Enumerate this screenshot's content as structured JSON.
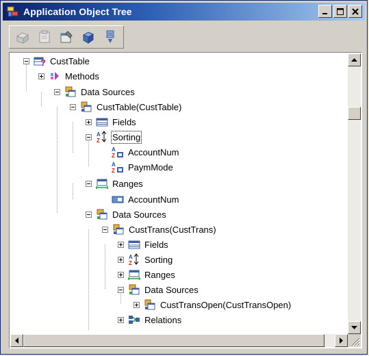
{
  "window": {
    "title": "Application Object Tree"
  },
  "toolbar": {
    "buttons": [
      "new-icon",
      "new-item-icon",
      "properties-icon",
      "save-icon",
      "filter-icon"
    ]
  },
  "tree": {
    "nodes": [
      {
        "label": "CustTable",
        "expander": "minus",
        "icon": "table-icon"
      },
      {
        "label": "Methods",
        "expander": "plus",
        "icon": "methods-icon"
      },
      {
        "label": "Data Sources",
        "expander": "minus",
        "icon": "data-sources-icon"
      },
      {
        "label": "CustTable(CustTable)",
        "expander": "minus",
        "icon": "data-source-icon"
      },
      {
        "label": "Fields",
        "expander": "plus",
        "icon": "fields-icon"
      },
      {
        "label": "Sorting",
        "expander": "minus",
        "icon": "sort-az-icon",
        "selected": true
      },
      {
        "label": "AccountNum",
        "expander": "",
        "icon": "sort-field-icon"
      },
      {
        "label": "PaymMode",
        "expander": "",
        "icon": "sort-field-icon"
      },
      {
        "label": "Ranges",
        "expander": "minus",
        "icon": "ranges-icon"
      },
      {
        "label": "AccountNum",
        "expander": "",
        "icon": "range-field-icon"
      },
      {
        "label": "Data Sources",
        "expander": "minus",
        "icon": "data-sources-icon"
      },
      {
        "label": "CustTrans(CustTrans)",
        "expander": "minus",
        "icon": "data-source-icon"
      },
      {
        "label": "Fields",
        "expander": "plus",
        "icon": "fields-icon"
      },
      {
        "label": "Sorting",
        "expander": "plus",
        "icon": "sort-az-icon"
      },
      {
        "label": "Ranges",
        "expander": "plus",
        "icon": "ranges-icon"
      },
      {
        "label": "Data Sources",
        "expander": "minus",
        "icon": "data-sources-icon"
      },
      {
        "label": "CustTransOpen(CustTransOpen)",
        "expander": "plus",
        "icon": "data-source-icon"
      },
      {
        "label": "Relations",
        "expander": "plus",
        "icon": "relations-icon"
      }
    ]
  },
  "colors": {
    "title_start": "#0a246a",
    "title_end": "#a6caf0",
    "window_face": "#d4d0c8"
  }
}
